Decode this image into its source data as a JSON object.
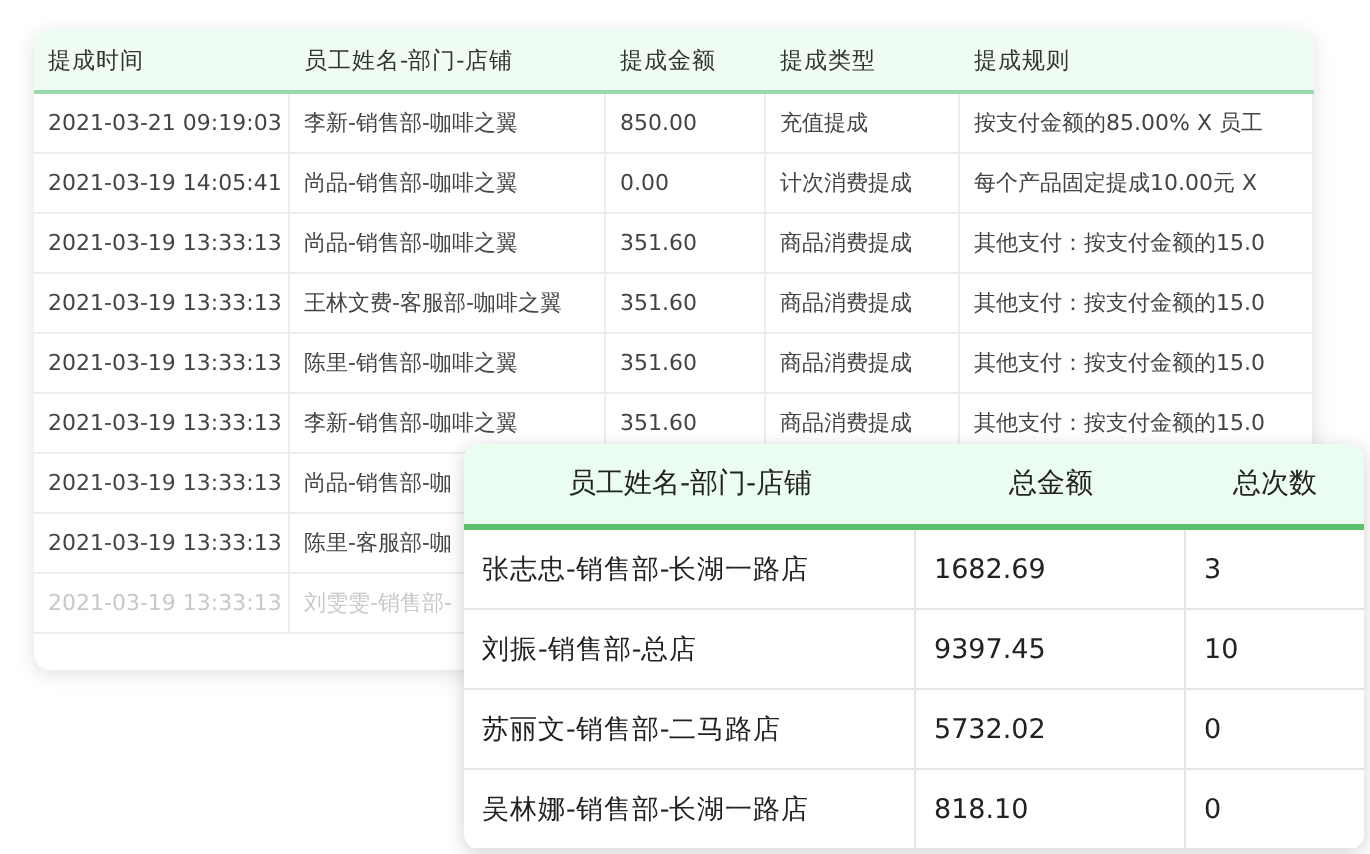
{
  "detail_table": {
    "columns": [
      "提成时间",
      "员工姓名-部门-店铺",
      "提成金额",
      "提成类型",
      "提成规则"
    ],
    "rows": [
      {
        "faded": false,
        "cells": [
          "2021-03-21 09:19:03",
          "李新-销售部-咖啡之翼",
          "850.00",
          "充值提成",
          "按支付金额的85.00% X 员工"
        ]
      },
      {
        "faded": false,
        "cells": [
          "2021-03-19 14:05:41",
          "尚品-销售部-咖啡之翼",
          "0.00",
          "计次消费提成",
          "每个产品固定提成10.00元 X"
        ]
      },
      {
        "faded": false,
        "cells": [
          "2021-03-19 13:33:13",
          "尚品-销售部-咖啡之翼",
          "351.60",
          "商品消费提成",
          "其他支付：按支付金额的15.0"
        ]
      },
      {
        "faded": false,
        "cells": [
          "2021-03-19 13:33:13",
          "王林文费-客服部-咖啡之翼",
          "351.60",
          "商品消费提成",
          "其他支付：按支付金额的15.0"
        ]
      },
      {
        "faded": false,
        "cells": [
          "2021-03-19 13:33:13",
          "陈里-销售部-咖啡之翼",
          "351.60",
          "商品消费提成",
          "其他支付：按支付金额的15.0"
        ]
      },
      {
        "faded": false,
        "cells": [
          "2021-03-19 13:33:13",
          "李新-销售部-咖啡之翼",
          "351.60",
          "商品消费提成",
          "其他支付：按支付金额的15.0"
        ]
      },
      {
        "faded": false,
        "cells": [
          "2021-03-19 13:33:13",
          "尚品-销售部-咖"
        ]
      },
      {
        "faded": false,
        "cells": [
          "2021-03-19 13:33:13",
          "陈里-客服部-咖"
        ]
      },
      {
        "faded": true,
        "cells": [
          "2021-03-19 13:33:13",
          "刘雯雯-销售部-"
        ]
      }
    ]
  },
  "summary_table": {
    "columns": [
      "员工姓名-部门-店铺",
      "总金额",
      "总次数"
    ],
    "rows": [
      [
        "张志忠-销售部-长湖一路店",
        "1682.69",
        "3"
      ],
      [
        "刘振-销售部-总店",
        "9397.45",
        "10"
      ],
      [
        "苏丽文-销售部-二马路店",
        "5732.02",
        "0"
      ],
      [
        "吴林娜-销售部-长湖一路店",
        "818.10",
        "0"
      ]
    ]
  }
}
